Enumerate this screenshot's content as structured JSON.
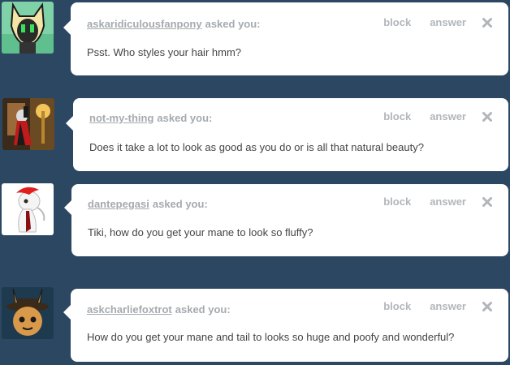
{
  "actions": {
    "block_label": "block",
    "answer_label": "answer"
  },
  "asked_suffix": "asked you:",
  "asks": [
    {
      "asker": "askaridiculousfanpony",
      "question": "Psst. Who styles your hair hmm?"
    },
    {
      "asker": "not-my-thing",
      "question": "Does it take a lot to look as good as you do or is all that natural beauty?"
    },
    {
      "asker": "dantepegasi",
      "question": "Tiki, how do you get your mane to look so fluffy?"
    },
    {
      "asker": "askcharliefoxtrot",
      "question": "How do you get your mane and tail to looks so huge and poofy and wonderful?"
    }
  ]
}
